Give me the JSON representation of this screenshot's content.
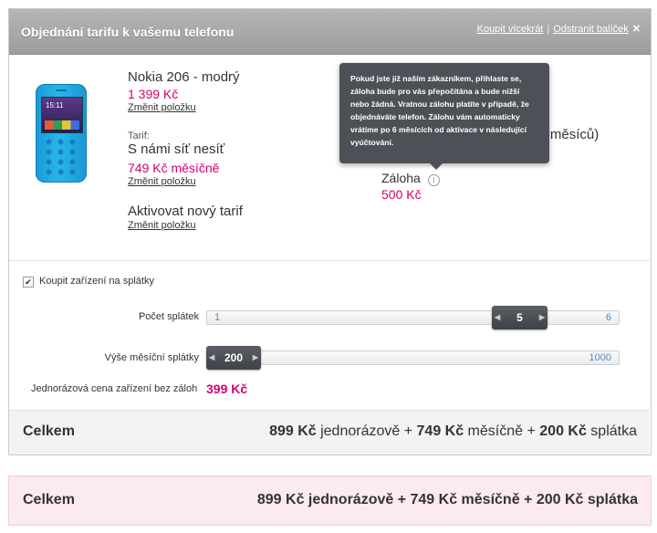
{
  "header": {
    "title": "Objednání tarifu k vašemu telefonu",
    "buy_more_link": "Koupit vícekrát",
    "separator": "|",
    "remove_link": "Odstranit balíček",
    "close_symbol": "✕"
  },
  "product": {
    "name": "Nokia 206 - modrý",
    "price": "1 399 Kč",
    "change_label": "Změnit položku",
    "image_icon": "phone-image",
    "screen_time": "15:11"
  },
  "tariff": {
    "label": "Tarif:",
    "name": "S námi síť nesíť",
    "price": "749 Kč měsíčně",
    "change_label": "Změnit položku"
  },
  "activation": {
    "title": "Aktivovat nový tarif",
    "change_label": "Změnit položku"
  },
  "commitment": {
    "text": "24 měsíců)"
  },
  "deposit": {
    "label": "Záloha",
    "value": "500 Kč",
    "info_icon": "i"
  },
  "tooltip": {
    "text": "Pokud jste již naším zákazníkem, přihlaste se, záloha bude pro vás přepočítána a bude nižší nebo žádná. Vratnou zálohu platíte v případě, že objednáváte telefon. Zálohu vám automaticky vrátíme po 6 měsících od aktivace v následující vyúčtování."
  },
  "installments": {
    "checkbox_label": "Koupit zařízení na splátky",
    "checked": true,
    "checkmark": "✔",
    "count_label": "Počet splátek",
    "count_min": "1",
    "count_max": "6",
    "count_value": "5",
    "amount_label": "Výše měsíční splátky",
    "amount_value": "200",
    "amount_max": "1000",
    "one_time_label": "Jednorázová cena zařízení bez záloh",
    "one_time_value": "399 Kč",
    "arrow_left": "◀",
    "arrow_right": "▶"
  },
  "total1": {
    "label": "Celkem",
    "one_time_amount": "899 Kč",
    "one_time_text": " jednorázově + ",
    "monthly_amount": "749 Kč",
    "monthly_text": " měsíčně + ",
    "installment_amount": "200 Kč",
    "installment_text": " splátka"
  },
  "total2": {
    "label": "Celkem",
    "text": "899 Kč jednorázově + 749 Kč měsíčně + 200 Kč splátka"
  },
  "colors": {
    "accent": "#d5006d",
    "header_bg": "#a9a9a9",
    "slider_handle": "#4a4e54",
    "total_highlight_bg": "#fbeaf1"
  }
}
